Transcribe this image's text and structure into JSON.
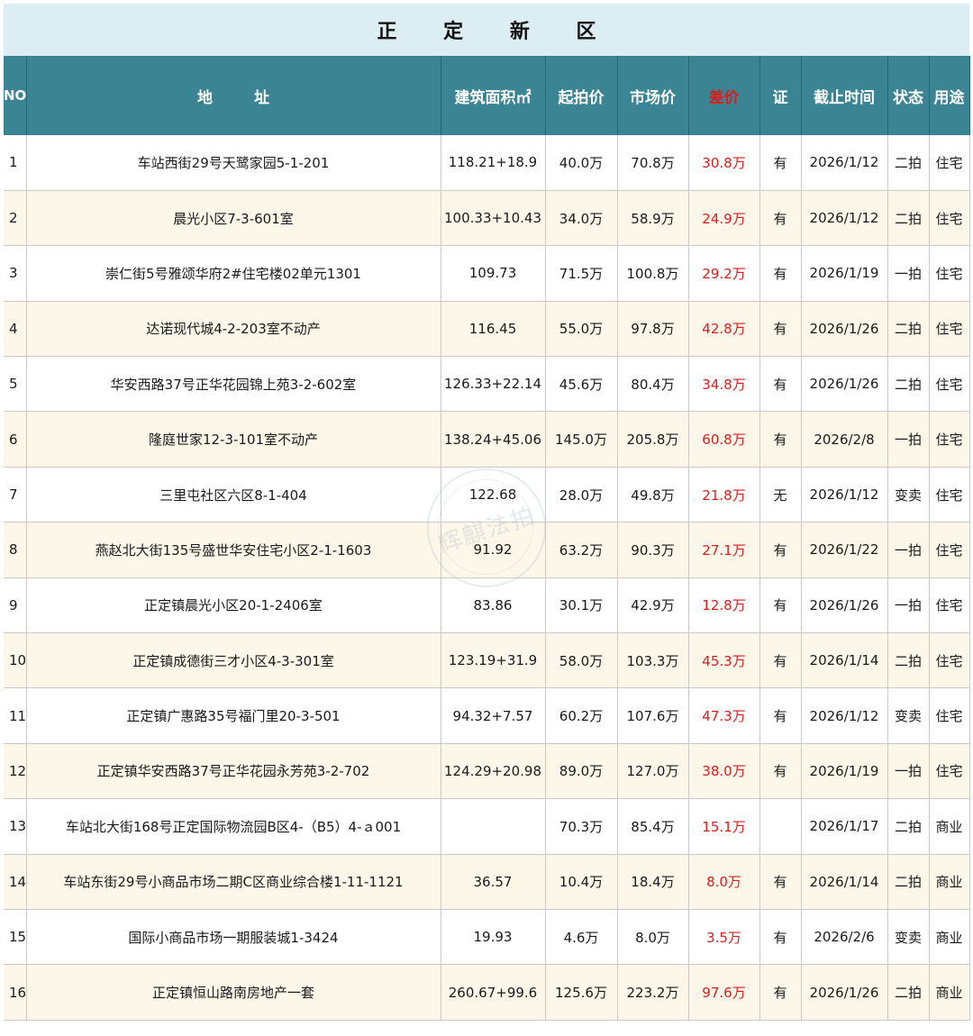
{
  "title": "正 定 新 区",
  "headers": {
    "no": "NO.",
    "address": "地 址",
    "area": "建筑面积㎡",
    "start_price": "起拍价",
    "market_price": "市场价",
    "diff": "差价",
    "cert": "证",
    "deadline": "截止时间",
    "status": "状态",
    "usage": "用途"
  },
  "colors": {
    "header_bg": "#3b8494",
    "title_bg": "#dcedf4",
    "row_alt_bg": "#fdf7e9",
    "diff_red": "#d81e1e"
  },
  "watermark": "辉麒法拍",
  "rows": [
    {
      "no": "1",
      "address": "车站西街29号天鹭家园5-1-201",
      "area": "118.21+18.9",
      "start": "40.0万",
      "market": "70.8万",
      "diff": "30.8万",
      "cert": "有",
      "deadline": "2026/1/12",
      "status": "二拍",
      "usage": "住宅"
    },
    {
      "no": "2",
      "address": "晨光小区7-3-601室",
      "area": "100.33+10.43",
      "start": "34.0万",
      "market": "58.9万",
      "diff": "24.9万",
      "cert": "有",
      "deadline": "2026/1/12",
      "status": "二拍",
      "usage": "住宅"
    },
    {
      "no": "3",
      "address": "崇仁街5号雅颂华府2#住宅楼02单元1301",
      "area": "109.73",
      "start": "71.5万",
      "market": "100.8万",
      "diff": "29.2万",
      "cert": "有",
      "deadline": "2026/1/19",
      "status": "一拍",
      "usage": "住宅"
    },
    {
      "no": "4",
      "address": "达诺现代城4-2-203室不动产",
      "area": "116.45",
      "start": "55.0万",
      "market": "97.8万",
      "diff": "42.8万",
      "cert": "有",
      "deadline": "2026/1/26",
      "status": "二拍",
      "usage": "住宅"
    },
    {
      "no": "5",
      "address": "华安西路37号正华花园锦上苑3-2-602室",
      "area": "126.33+22.14",
      "start": "45.6万",
      "market": "80.4万",
      "diff": "34.8万",
      "cert": "有",
      "deadline": "2026/1/26",
      "status": "二拍",
      "usage": "住宅"
    },
    {
      "no": "6",
      "address": "隆庭世家12-3-101室不动产",
      "area": "138.24+45.06",
      "start": "145.0万",
      "market": "205.8万",
      "diff": "60.8万",
      "cert": "有",
      "deadline": "2026/2/8",
      "status": "一拍",
      "usage": "住宅"
    },
    {
      "no": "7",
      "address": "三里屯社区六区8-1-404",
      "area": "122.68",
      "start": "28.0万",
      "market": "49.8万",
      "diff": "21.8万",
      "cert": "无",
      "deadline": "2026/1/12",
      "status": "变卖",
      "usage": "住宅"
    },
    {
      "no": "8",
      "address": "燕赵北大街135号盛世华安住宅小区2-1-1603",
      "area": "91.92",
      "start": "63.2万",
      "market": "90.3万",
      "diff": "27.1万",
      "cert": "有",
      "deadline": "2026/1/22",
      "status": "一拍",
      "usage": "住宅"
    },
    {
      "no": "9",
      "address": "正定镇晨光小区20-1-2406室",
      "area": "83.86",
      "start": "30.1万",
      "market": "42.9万",
      "diff": "12.8万",
      "cert": "有",
      "deadline": "2026/1/26",
      "status": "一拍",
      "usage": "住宅"
    },
    {
      "no": "10",
      "address": "正定镇成德街三才小区4-3-301室",
      "area": "123.19+31.9",
      "start": "58.0万",
      "market": "103.3万",
      "diff": "45.3万",
      "cert": "有",
      "deadline": "2026/1/14",
      "status": "二拍",
      "usage": "住宅"
    },
    {
      "no": "11",
      "address": "正定镇广惠路35号福门里20-3-501",
      "area": "94.32+7.57",
      "start": "60.2万",
      "market": "107.6万",
      "diff": "47.3万",
      "cert": "有",
      "deadline": "2026/1/12",
      "status": "变卖",
      "usage": "住宅"
    },
    {
      "no": "12",
      "address": "正定镇华安西路37号正华花园永芳苑3-2-702",
      "area": "124.29+20.98",
      "start": "89.0万",
      "market": "127.0万",
      "diff": "38.0万",
      "cert": "有",
      "deadline": "2026/1/19",
      "status": "一拍",
      "usage": "住宅"
    },
    {
      "no": "13",
      "address": "车站北大街168号正定国际物流园B区4-（B5）4-ａ001",
      "area": "",
      "start": "70.3万",
      "market": "85.4万",
      "diff": "15.1万",
      "cert": "",
      "deadline": "2026/1/17",
      "status": "二拍",
      "usage": "商业"
    },
    {
      "no": "14",
      "address": "车站东街29号小商品市场二期C区商业综合楼1-11-1121",
      "area": "36.57",
      "start": "10.4万",
      "market": "18.4万",
      "diff": "8.0万",
      "cert": "有",
      "deadline": "2026/1/14",
      "status": "二拍",
      "usage": "商业"
    },
    {
      "no": "15",
      "address": "国际小商品市场一期服装城1-3424",
      "area": "19.93",
      "start": "4.6万",
      "market": "8.0万",
      "diff": "3.5万",
      "cert": "有",
      "deadline": "2026/2/6",
      "status": "变卖",
      "usage": "商业"
    },
    {
      "no": "16",
      "address": "正定镇恒山路南房地产一套",
      "area": "260.67+99.6",
      "start": "125.6万",
      "market": "223.2万",
      "diff": "97.6万",
      "cert": "有",
      "deadline": "2026/1/26",
      "status": "二拍",
      "usage": "商业"
    }
  ]
}
